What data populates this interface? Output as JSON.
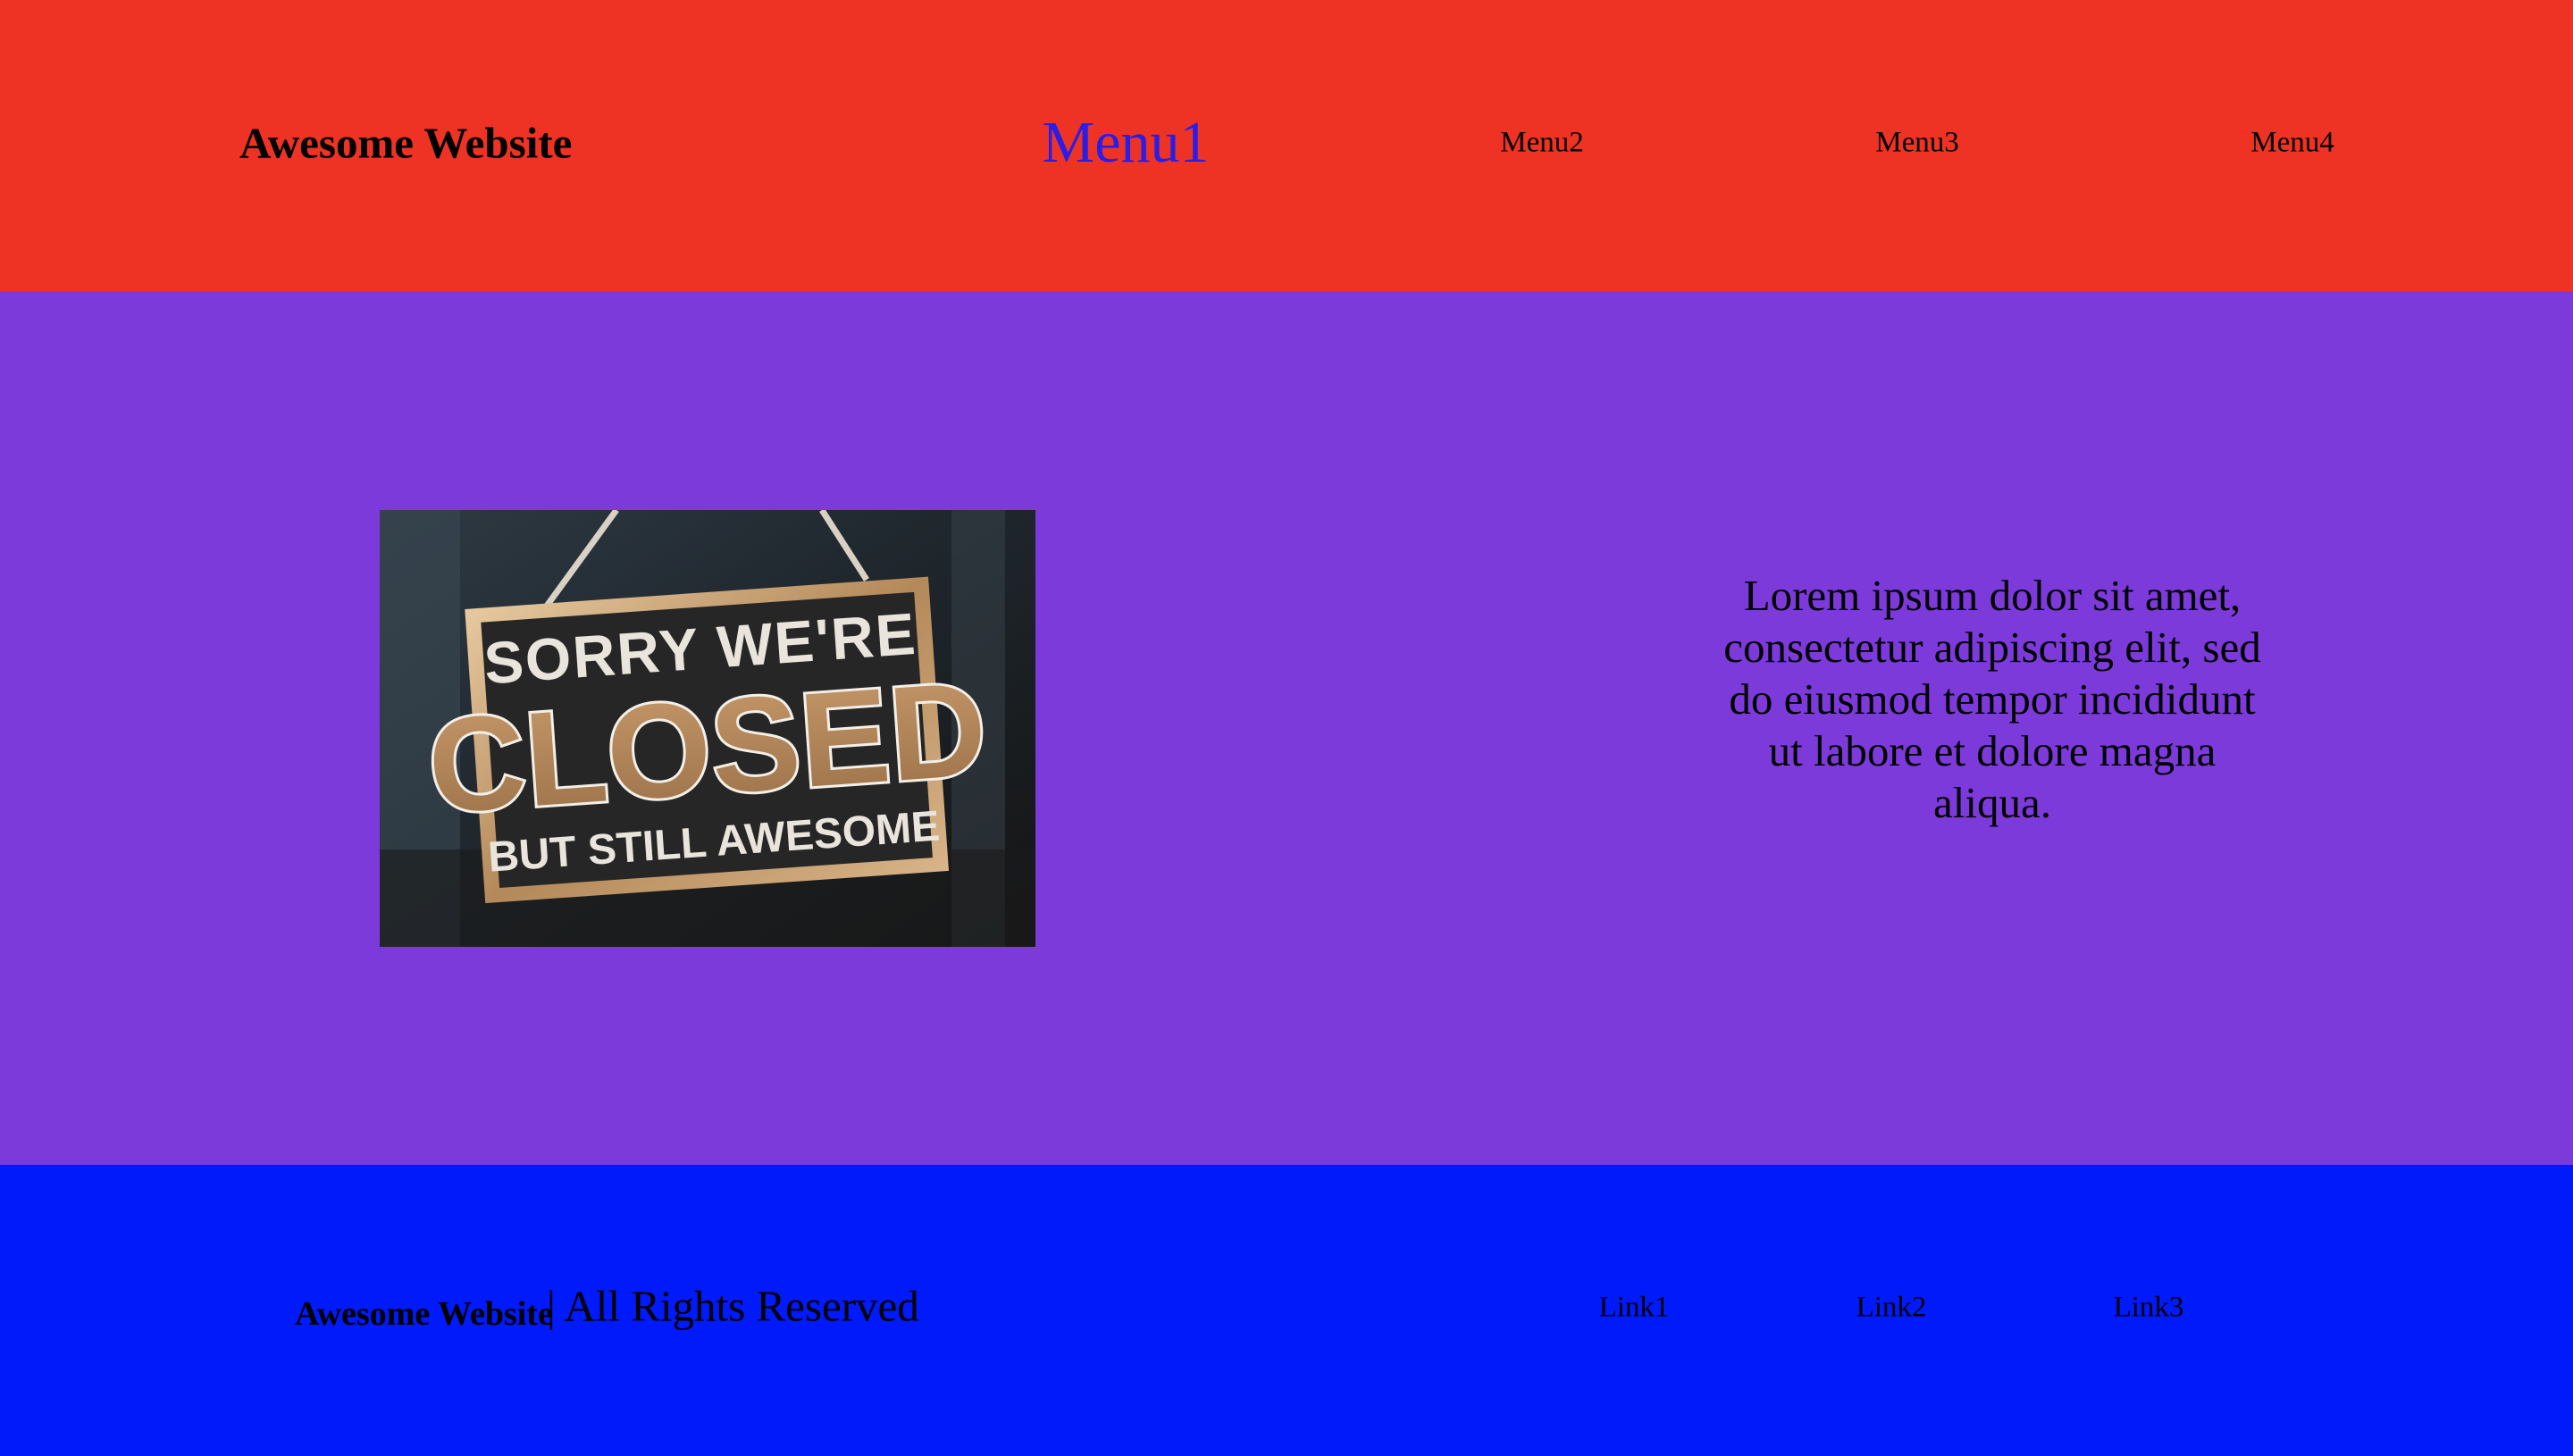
{
  "header": {
    "brand": "Awesome Website",
    "nav": [
      {
        "label": "Menu1",
        "active": true
      },
      {
        "label": "Menu2",
        "active": false
      },
      {
        "label": "Menu3",
        "active": false
      },
      {
        "label": "Menu4",
        "active": false
      }
    ]
  },
  "main": {
    "image": {
      "subject": "hanging-closed-sign",
      "line1": "SORRY WE'RE",
      "line2": "CLOSED",
      "line3": "BUT STILL AWESOME"
    },
    "text": "Lorem ipsum dolor sit amet, consectetur adipiscing elit, sed do eiusmod tempor incididunt ut labore et dolore magna aliqua."
  },
  "footer": {
    "brand": "Awesome Website",
    "rights": "| All Rights Reserved",
    "links": [
      "Link1",
      "Link2",
      "Link3"
    ]
  },
  "colors": {
    "header_bg": "#ee3325",
    "main_bg": "#7d3adb",
    "footer_bg": "#001af9",
    "active_nav": "#2a1ee6",
    "text": "#000000"
  }
}
